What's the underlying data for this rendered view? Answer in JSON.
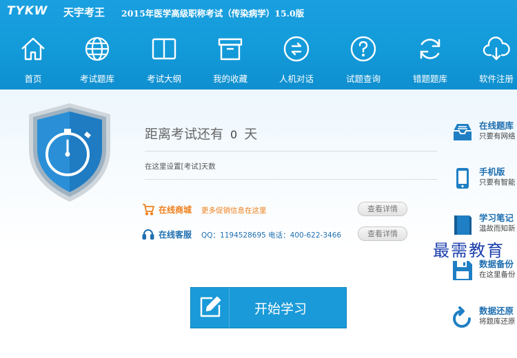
{
  "header": {
    "logo_text": "TYKW",
    "logo_name": "天宇考王",
    "app_title": "2015年医学高级职称考试（传染病学）15.0版"
  },
  "nav": [
    {
      "label": "首页",
      "icon": "home-icon"
    },
    {
      "label": "考试题库",
      "icon": "globe-icon"
    },
    {
      "label": "考试大纲",
      "icon": "book-icon"
    },
    {
      "label": "我的收藏",
      "icon": "archive-box-icon"
    },
    {
      "label": "人机对话",
      "icon": "exchange-icon"
    },
    {
      "label": "试题查询",
      "icon": "question-icon"
    },
    {
      "label": "错题题库",
      "icon": "refresh-icon"
    },
    {
      "label": "软件注册",
      "icon": "cloud-download-icon"
    }
  ],
  "countdown": {
    "prefix": "距离考试还有",
    "days": "0",
    "unit": "天",
    "set_link": "在这里设置[考试]天数"
  },
  "shop": {
    "label": "在线商城",
    "desc": "更多促销信息在这里",
    "button": "查看详情",
    "color": "#f07f1a"
  },
  "service": {
    "label": "在线客服",
    "desc": "QQ：1194528695 电话：400-622-3466",
    "button": "查看详情",
    "color": "#1f6fb0"
  },
  "start_button": {
    "label": "开始学习",
    "icon": "edit-icon"
  },
  "side": [
    {
      "title": "在线题库",
      "desc": "只要有网络",
      "icon": "inbox-icon"
    },
    {
      "title": "手机版",
      "desc": "只要有智能",
      "icon": "phone-icon"
    },
    {
      "title": "学习笔记",
      "desc": "温故而知新",
      "icon": "notebook-icon"
    },
    {
      "title": "数据备份",
      "desc": "在这里备份",
      "icon": "floppy-icon"
    },
    {
      "title": "数据还原",
      "desc": "将题库还原",
      "icon": "restore-icon"
    }
  ],
  "watermark": "最需教育",
  "colors": {
    "brand": "#139ad9",
    "accent_orange": "#f07f1a",
    "link_blue": "#1f6fb0"
  }
}
